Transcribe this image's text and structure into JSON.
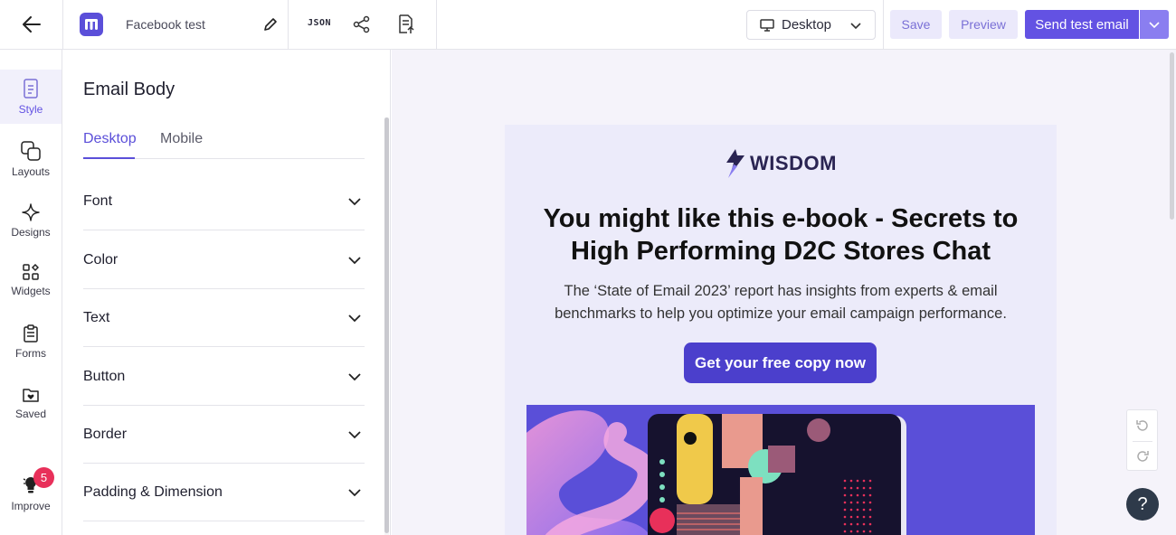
{
  "header": {
    "email_name": "Facebook test",
    "json_label": "JSON",
    "device_select": "Desktop",
    "save_label": "Save",
    "preview_label": "Preview",
    "send_label": "Send test email"
  },
  "rail": {
    "items": [
      {
        "label": "Style"
      },
      {
        "label": "Layouts"
      },
      {
        "label": "Designs"
      },
      {
        "label": "Widgets"
      },
      {
        "label": "Forms"
      },
      {
        "label": "Saved"
      },
      {
        "label": "Improve",
        "badge": "5"
      }
    ]
  },
  "panel": {
    "title": "Email Body",
    "tabs": [
      "Desktop",
      "Mobile"
    ],
    "sections": [
      "Font",
      "Color",
      "Text",
      "Button",
      "Border",
      "Padding & Dimension"
    ]
  },
  "email": {
    "brand": "WISDOM",
    "headline": "You might like this e-book - Secrets to High Performing D2C Stores Chat",
    "subtext": "The ‘State of Email 2023’ report has insights from experts & email benchmarks to help you optimize your email campaign performance.",
    "cta": "Get your free copy now"
  },
  "help_label": "?",
  "colors": {
    "accent": "#6352e3",
    "accent_light": "#ebe9fb",
    "badge": "#e8305a",
    "email_bg": "#ecebfa",
    "cta_bg": "#4b3fcc"
  }
}
